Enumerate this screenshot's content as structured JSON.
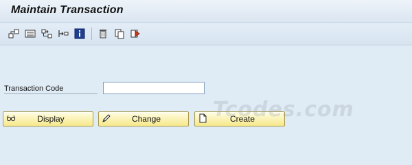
{
  "header": {
    "title": "Maintain Transaction"
  },
  "toolbar": {
    "icons": [
      "other-object-icon",
      "display-object-list-icon",
      "where-used-list-icon",
      "test-transaction-icon",
      "information-icon",
      "delete-icon",
      "copy-icon",
      "variants-icon"
    ]
  },
  "form": {
    "transaction_code_label": "Transaction Code",
    "transaction_code_value": ""
  },
  "actions": {
    "display_label": "Display",
    "change_label": "Change",
    "create_label": "Create"
  },
  "watermark": {
    "text": "Tcodes.com"
  },
  "colors": {
    "background": "#dfebf5",
    "button_fill": "#f6e98a",
    "input_border": "#7f9db9"
  }
}
